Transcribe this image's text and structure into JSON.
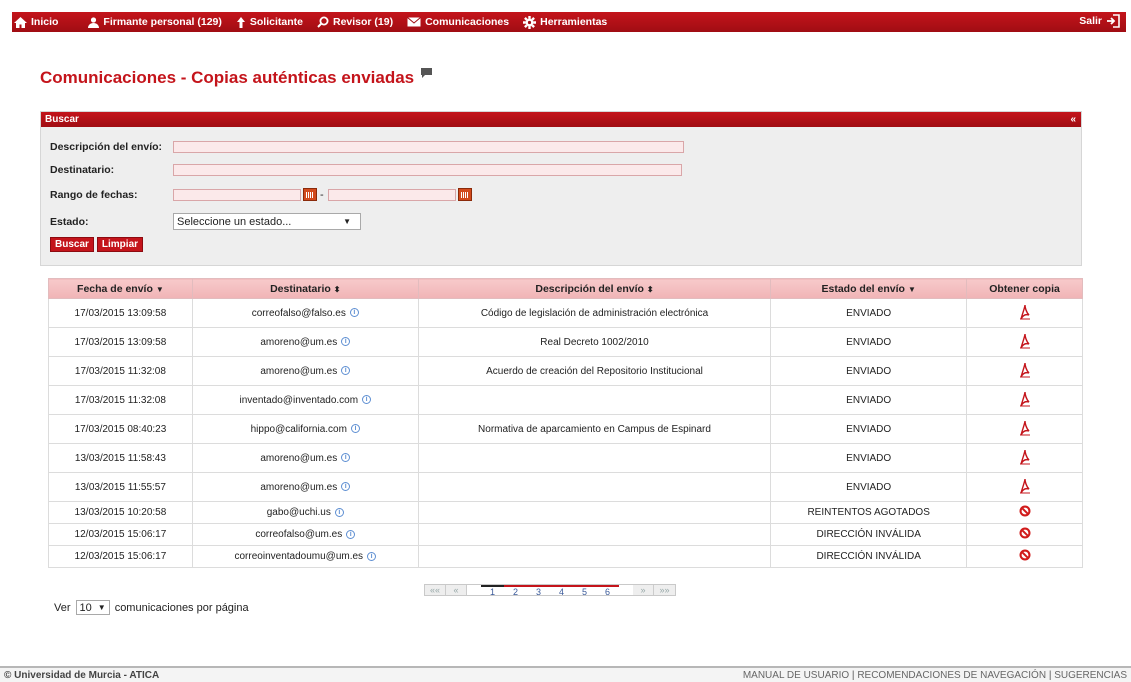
{
  "nav": {
    "home": "Inicio",
    "firmante": "Firmante personal (129)",
    "solicitante": "Solicitante",
    "revisor": "Revisor (19)",
    "comunicaciones": "Comunicaciones",
    "herramientas": "Herramientas",
    "salir": "Salir"
  },
  "page_title": "Comunicaciones - Copias auténticas enviadas",
  "search": {
    "header": "Buscar",
    "collapse": "«",
    "descripcion_label": "Descripción del envío:",
    "descripcion_value": "",
    "destinatario_label": "Destinatario:",
    "destinatario_value": "",
    "fechas_label": "Rango de fechas:",
    "fecha_desde": "",
    "fecha_hasta": "",
    "separator": "-",
    "estado_label": "Estado:",
    "estado_value": "Seleccione un estado...",
    "buscar_button": "Buscar",
    "limpiar_button": "Limpiar"
  },
  "table": {
    "headers": [
      "Fecha de envío",
      "Destinatario",
      "Descripción del envío",
      "Estado del envío",
      "Obtener copia"
    ],
    "rows": [
      {
        "fecha": "17/03/2015 13:09:58",
        "destinatario": "correofalso@falso.es",
        "descripcion": "Código de legislación de administración electrónica",
        "estado": "ENVIADO",
        "copia": "pdf"
      },
      {
        "fecha": "17/03/2015 13:09:58",
        "destinatario": "amoreno@um.es",
        "descripcion": "Real Decreto 1002/2010",
        "estado": "ENVIADO",
        "copia": "pdf"
      },
      {
        "fecha": "17/03/2015 11:32:08",
        "destinatario": "amoreno@um.es",
        "descripcion": "Acuerdo de creación del Repositorio Institucional",
        "estado": "ENVIADO",
        "copia": "pdf"
      },
      {
        "fecha": "17/03/2015 11:32:08",
        "destinatario": "inventado@inventado.com",
        "descripcion": "",
        "estado": "ENVIADO",
        "copia": "pdf"
      },
      {
        "fecha": "17/03/2015 08:40:23",
        "destinatario": "hippo@california.com",
        "descripcion": "Normativa de aparcamiento en Campus de Espinard",
        "estado": "ENVIADO",
        "copia": "pdf"
      },
      {
        "fecha": "13/03/2015 11:58:43",
        "destinatario": "amoreno@um.es",
        "descripcion": "",
        "estado": "ENVIADO",
        "copia": "pdf"
      },
      {
        "fecha": "13/03/2015 11:55:57",
        "destinatario": "amoreno@um.es",
        "descripcion": "",
        "estado": "ENVIADO",
        "copia": "pdf"
      },
      {
        "fecha": "13/03/2015 10:20:58",
        "destinatario": "gabo@uchi.us",
        "descripcion": "",
        "estado": "REINTENTOS AGOTADOS",
        "copia": "blocked"
      },
      {
        "fecha": "12/03/2015 15:06:17",
        "destinatario": "correofalso@um.es",
        "descripcion": "",
        "estado": "DIRECCIÓN INVÁLIDA",
        "copia": "blocked"
      },
      {
        "fecha": "12/03/2015 15:06:17",
        "destinatario": "correoinventadoumu@um.es",
        "descripcion": "",
        "estado": "DIRECCIÓN INVÁLIDA",
        "copia": "blocked"
      }
    ]
  },
  "pager": {
    "first": "««",
    "prev": "«",
    "pages": [
      "1",
      "2",
      "3",
      "4",
      "5",
      "6"
    ],
    "current": "1",
    "next": "»",
    "last": "»»"
  },
  "perpage": {
    "prefix": "Ver",
    "value": "10",
    "suffix": "comunicaciones por página"
  },
  "footer": {
    "copyright": "© Universidad de Murcia - ATICA",
    "manual": "MANUAL DE USUARIO",
    "recomendaciones": "RECOMENDACIONES DE NAVEGACIÓN",
    "sugerencias": "SUGERENCIAS",
    "sep": " | "
  },
  "colors": {
    "brand_red": "#c4141b",
    "header_pink": "#f3bdbf",
    "input_pink": "#fbe9ea"
  }
}
